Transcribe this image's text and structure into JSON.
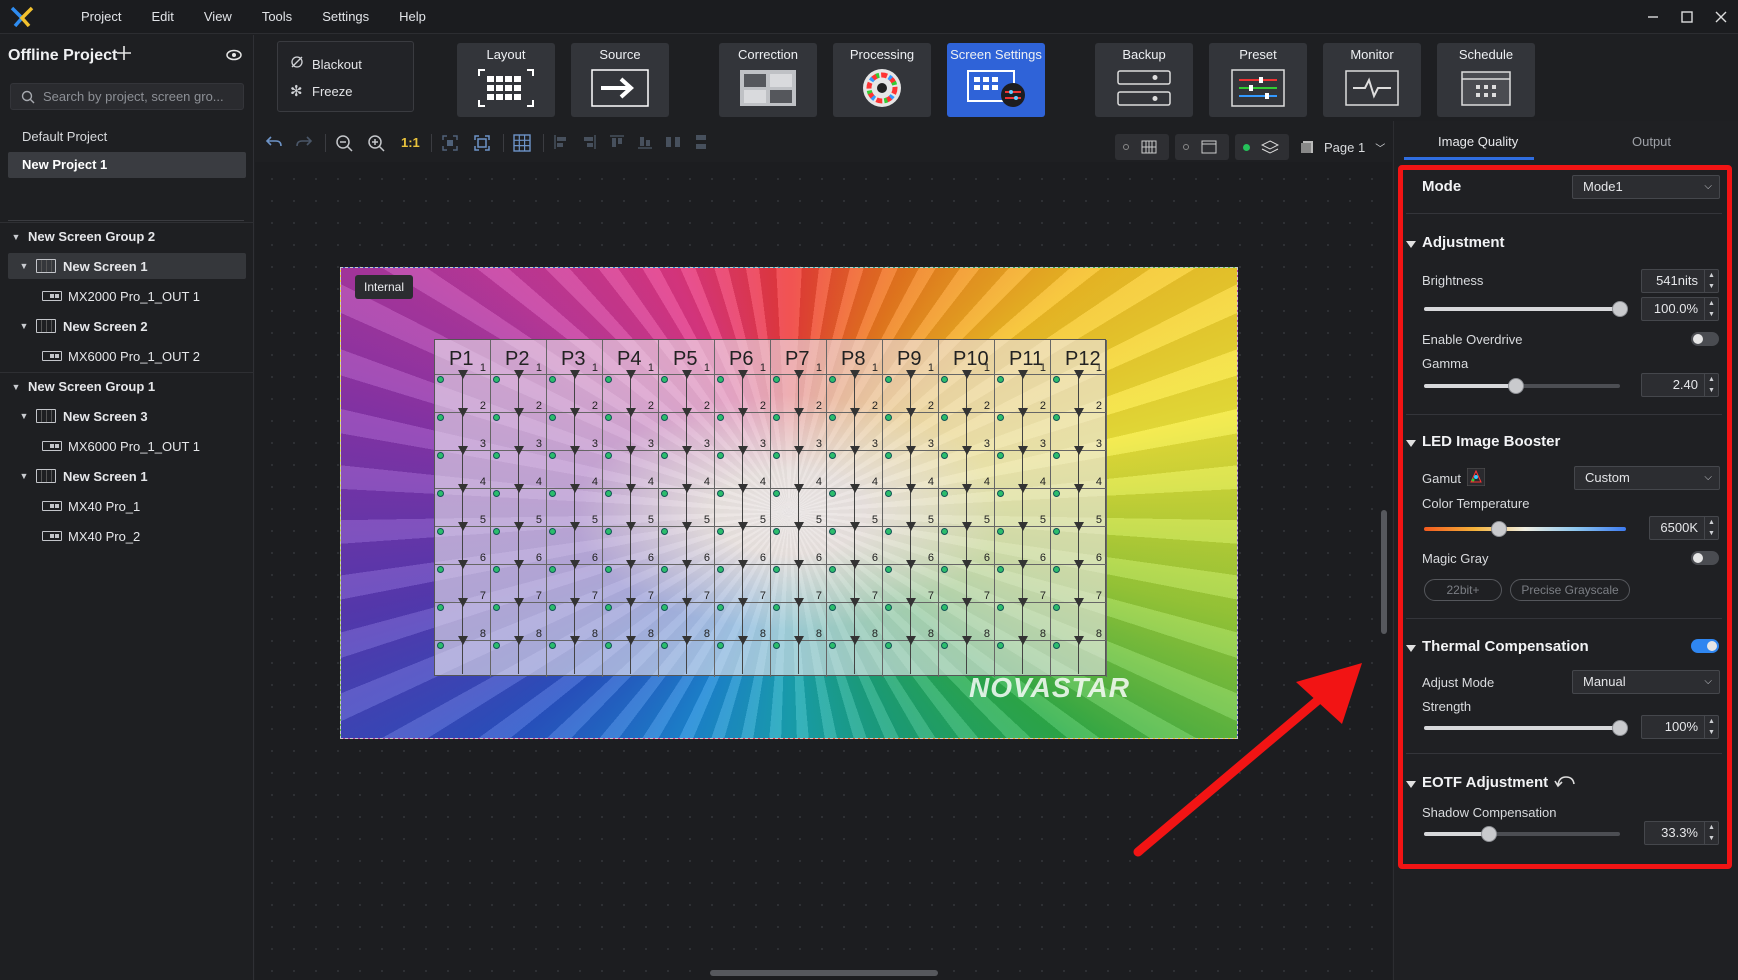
{
  "menubar": {
    "items": [
      "Project",
      "Edit",
      "View",
      "Tools",
      "Settings",
      "Help"
    ]
  },
  "left": {
    "project_title": "Offline Project",
    "search_placeholder": "Search by project, screen gro...",
    "projects": [
      "Default Project",
      "New Project 1"
    ],
    "tree": [
      {
        "kind": "group",
        "label": "New Screen Group 2"
      },
      {
        "kind": "screen",
        "label": "New Screen 1"
      },
      {
        "kind": "device",
        "label": "MX2000 Pro_1_OUT 1"
      },
      {
        "kind": "screen",
        "label": "New Screen 2"
      },
      {
        "kind": "device",
        "label": "MX6000 Pro_1_OUT 2"
      },
      {
        "kind": "group",
        "label": "New Screen Group 1"
      },
      {
        "kind": "screen",
        "label": "New Screen 3"
      },
      {
        "kind": "device",
        "label": "MX6000 Pro_1_OUT 1"
      },
      {
        "kind": "screen",
        "label": "New Screen 1"
      },
      {
        "kind": "device",
        "label": "MX40 Pro_1"
      },
      {
        "kind": "device",
        "label": "MX40 Pro_2"
      }
    ]
  },
  "toolbar": {
    "blackout": "Blackout",
    "freeze": "Freeze",
    "buttons": [
      "Layout",
      "Source",
      "Correction",
      "Processing",
      "Screen Settings",
      "Backup",
      "Preset",
      "Monitor",
      "Schedule"
    ],
    "active": "Screen Settings"
  },
  "subbar": {
    "ratio": "1:1",
    "page": "Page 1"
  },
  "canvas": {
    "badge": "Internal",
    "brand": "NOVASTAR",
    "columns": [
      "P1",
      "P2",
      "P3",
      "P4",
      "P5",
      "P6",
      "P7",
      "P8",
      "P9",
      "P10",
      "P11",
      "P12"
    ],
    "row_numbers": [
      "1",
      "2",
      "3",
      "4",
      "5",
      "6",
      "7",
      "8"
    ]
  },
  "right": {
    "tabs": [
      "Image Quality",
      "Output"
    ],
    "mode_label": "Mode",
    "mode_value": "Mode1",
    "adjustment": {
      "title": "Adjustment",
      "brightness_label": "Brightness",
      "brightness_nits": "541nits",
      "brightness_pct": "100.0%",
      "brightness_level": 1.0,
      "overdrive_label": "Enable Overdrive",
      "overdrive_on": false,
      "gamma_label": "Gamma",
      "gamma_value": "2.40",
      "gamma_level": 0.47
    },
    "booster": {
      "title": "LED Image Booster",
      "gamut_label": "Gamut",
      "gamut_value": "Custom",
      "color_temp_label": "Color Temperature",
      "color_temp_value": "6500K",
      "color_temp_level": 0.37,
      "magic_gray_label": "Magic Gray",
      "magic_gray_on": false,
      "pill_1": "22bit+",
      "pill_2": "Precise Grayscale"
    },
    "thermal": {
      "title": "Thermal Compensation",
      "enabled": true,
      "adjust_mode_label": "Adjust Mode",
      "adjust_mode_value": "Manual",
      "strength_label": "Strength",
      "strength_value": "100%",
      "strength_level": 1.0
    },
    "eotf": {
      "title": "EOTF Adjustment",
      "shadow_label": "Shadow Compensation",
      "shadow_value": "33.3%",
      "shadow_level": 0.333
    }
  },
  "colors": {
    "accent": "#2f63d8",
    "highlight": "#f21414",
    "toggle_on": "#2f86f0",
    "grid_dot": "#2bbd6c"
  }
}
